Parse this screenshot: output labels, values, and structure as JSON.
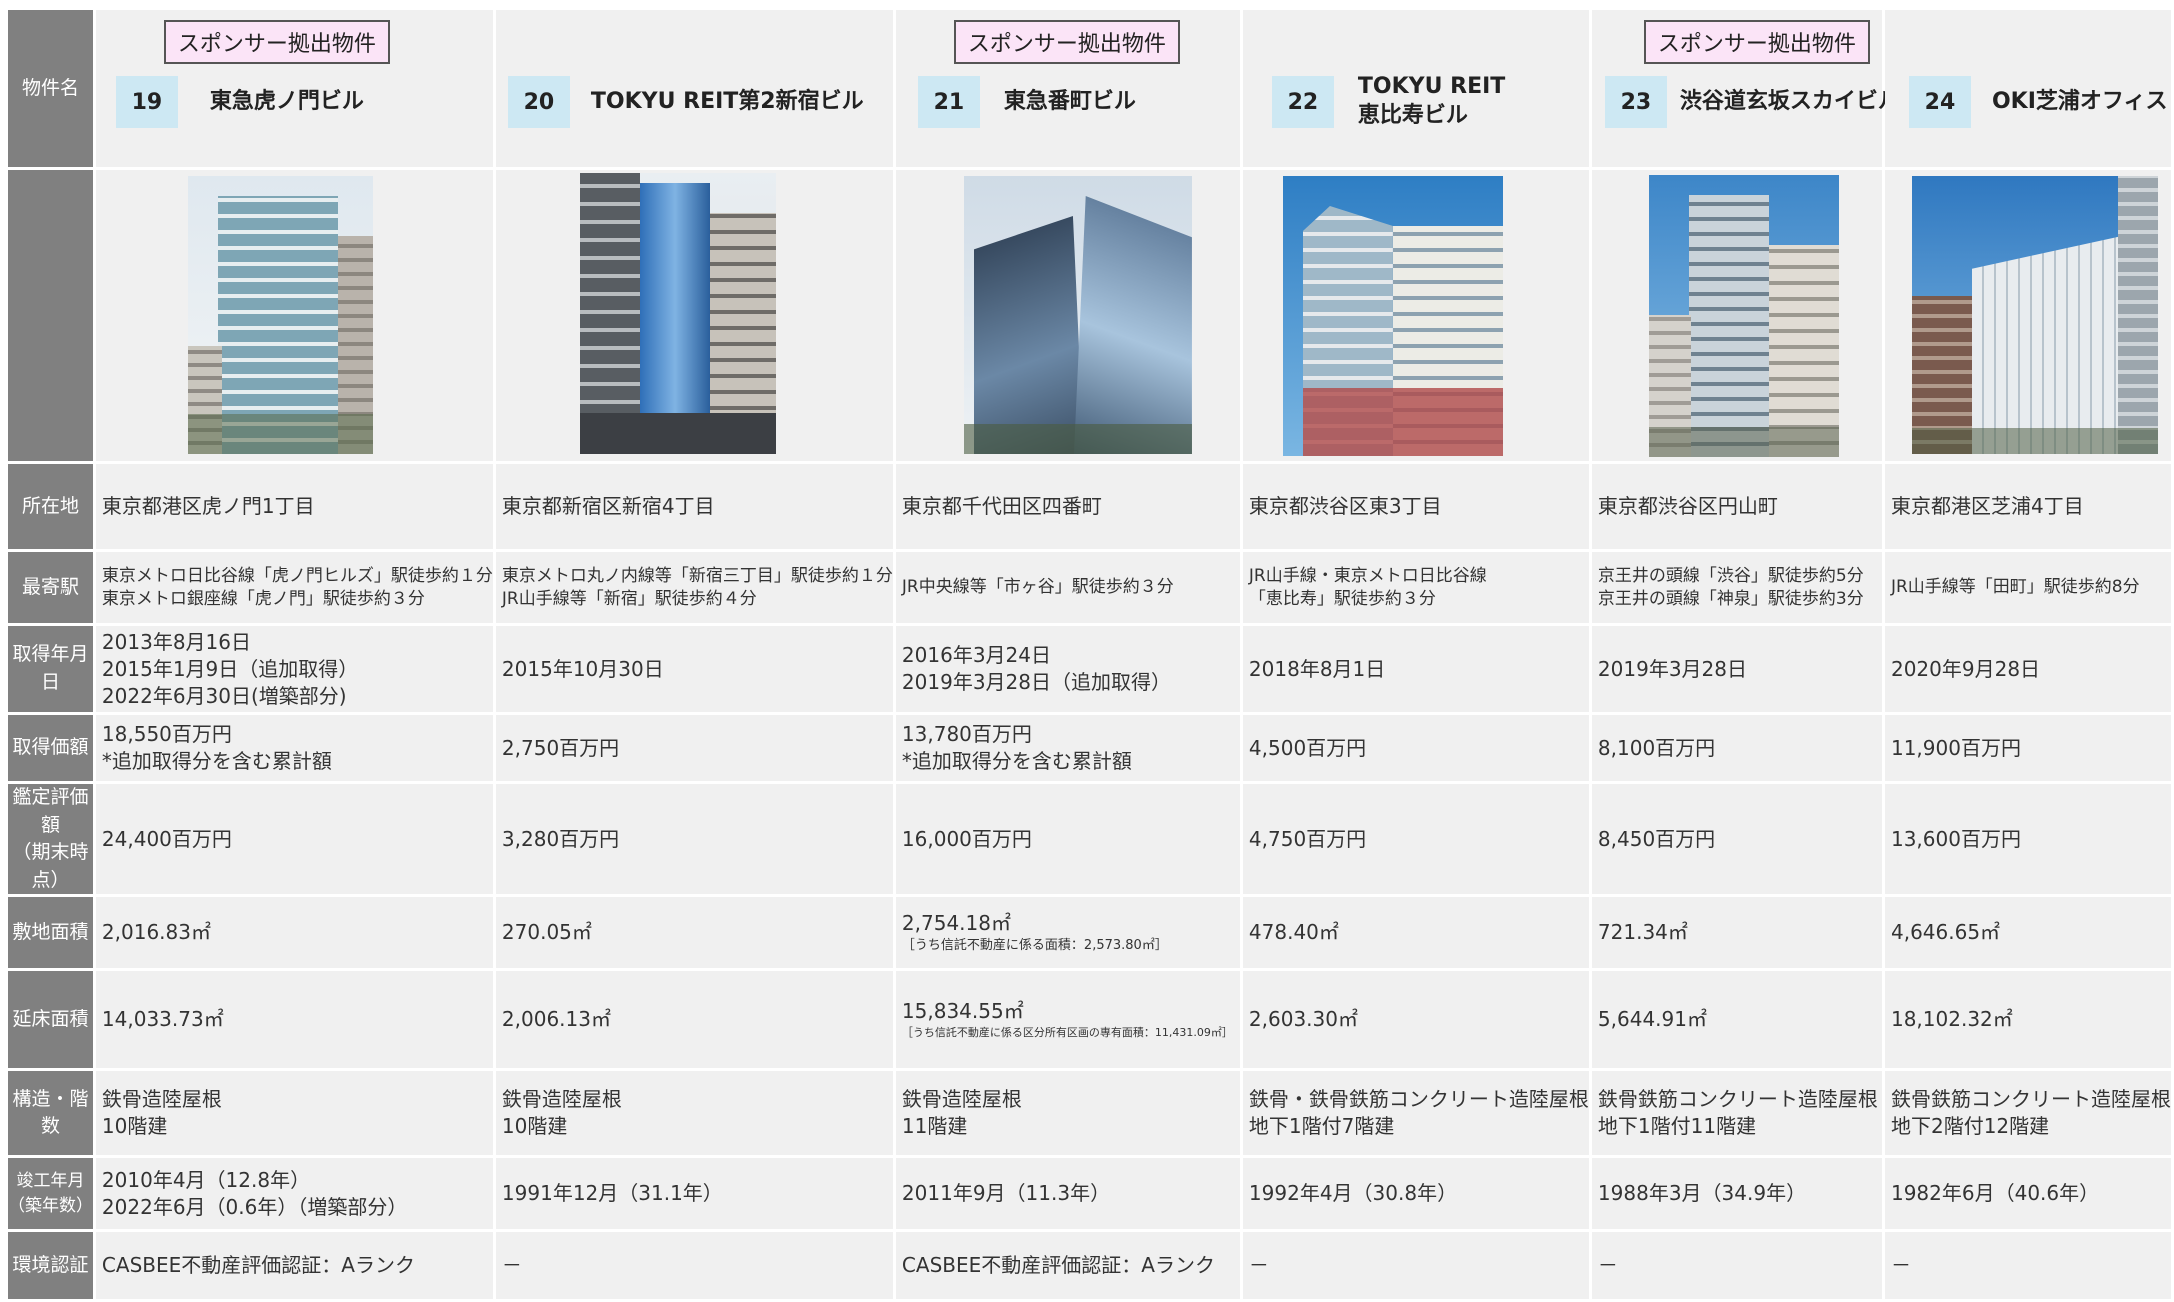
{
  "labels": {
    "name": "物件名",
    "location": "所在地",
    "station": "最寄駅",
    "acq_date": "取得年月日",
    "acq_price": "取得価額",
    "appraisal": [
      "鑑定評価額",
      "（期末時点）"
    ],
    "land_area": "敷地面積",
    "floor_area": "延床面積",
    "structure": "構造・階数",
    "completion": "竣工年月（築年数）",
    "env_cert": "環境認証"
  },
  "sponsor_badge": "スポンサー拠出物件",
  "properties": [
    {
      "number": "19",
      "name": [
        "東急虎ノ門ビル"
      ],
      "sponsor": true,
      "photo": "building-photo",
      "location": "東京都港区虎ノ門1丁目",
      "station": [
        "東京メトロ日比谷線「虎ノ門ヒルズ」駅徒歩約１分",
        "東京メトロ銀座線「虎ノ門」駅徒歩約３分"
      ],
      "acq_date": [
        "2013年8月16日",
        "2015年1月9日（追加取得）",
        "2022年6月30日(増築部分)"
      ],
      "acq_price": [
        "18,550百万円",
        "*追加取得分を含む累計額"
      ],
      "appraisal": "24,400百万円",
      "land_area": "2,016.83㎡",
      "land_note": "",
      "floor_area": "14,033.73㎡",
      "floor_note": "",
      "structure": [
        "鉄骨造陸屋根",
        "10階建"
      ],
      "completion": [
        "2010年4月（12.8年）",
        "2022年6月（0.6年）（増築部分）"
      ],
      "env_cert": "CASBEE不動産評価認証：Aランク"
    },
    {
      "number": "20",
      "name": [
        "TOKYU REIT第2新宿ビル"
      ],
      "sponsor": false,
      "photo": "building-photo",
      "location": "東京都新宿区新宿4丁目",
      "station": [
        "東京メトロ丸ノ内線等「新宿三丁目」駅徒歩約１分",
        "JR山手線等「新宿」駅徒歩約４分"
      ],
      "acq_date": [
        "2015年10月30日"
      ],
      "acq_price": [
        "2,750百万円"
      ],
      "appraisal": "3,280百万円",
      "land_area": "270.05㎡",
      "land_note": "",
      "floor_area": "2,006.13㎡",
      "floor_note": "",
      "structure": [
        "鉄骨造陸屋根",
        "10階建"
      ],
      "completion": [
        "1991年12月（31.1年）"
      ],
      "env_cert": "－"
    },
    {
      "number": "21",
      "name": [
        "東急番町ビル"
      ],
      "sponsor": true,
      "photo": "building-photo",
      "location": "東京都千代田区四番町",
      "station": [
        "JR中央線等「市ヶ谷」駅徒歩約３分"
      ],
      "acq_date": [
        "2016年3月24日",
        "2019年3月28日（追加取得）"
      ],
      "acq_price": [
        "13,780百万円",
        "*追加取得分を含む累計額"
      ],
      "appraisal": "16,000百万円",
      "land_area": "2,754.18㎡",
      "land_note": "［うち信託不動産に係る面積：2,573.80㎡］",
      "floor_area": "15,834.55㎡",
      "floor_note": "［うち信託不動産に係る区分所有区画の専有面積：11,431.09㎡］",
      "structure": [
        "鉄骨造陸屋根",
        "11階建"
      ],
      "completion": [
        "2011年9月（11.3年）"
      ],
      "env_cert": "CASBEE不動産評価認証：Aランク"
    },
    {
      "number": "22",
      "name": [
        "TOKYU REIT",
        "恵比寿ビル"
      ],
      "sponsor": false,
      "photo": "building-photo",
      "location": "東京都渋谷区東3丁目",
      "station": [
        "JR山手線・東京メトロ日比谷線",
        "「恵比寿」駅徒歩約３分"
      ],
      "acq_date": [
        "2018年8月1日"
      ],
      "acq_price": [
        "4,500百万円"
      ],
      "appraisal": "4,750百万円",
      "land_area": "478.40㎡",
      "land_note": "",
      "floor_area": "2,603.30㎡",
      "floor_note": "",
      "structure": [
        "鉄骨・鉄骨鉄筋コンクリート造陸屋根",
        "地下1階付7階建"
      ],
      "completion": [
        "1992年4月（30.8年）"
      ],
      "env_cert": "－"
    },
    {
      "number": "23",
      "name": [
        "渋谷道玄坂スカイビル"
      ],
      "sponsor": true,
      "photo": "building-photo",
      "location": "東京都渋谷区円山町",
      "station": [
        "京王井の頭線「渋谷」駅徒歩約5分",
        "京王井の頭線「神泉」駅徒歩約3分"
      ],
      "acq_date": [
        "2019年3月28日"
      ],
      "acq_price": [
        "8,100百万円"
      ],
      "appraisal": "8,450百万円",
      "land_area": "721.34㎡",
      "land_note": "",
      "floor_area": "5,644.91㎡",
      "floor_note": "",
      "structure": [
        "鉄骨鉄筋コンクリート造陸屋根",
        "地下1階付11階建"
      ],
      "completion": [
        "1988年3月（34.9年）"
      ],
      "env_cert": "－"
    },
    {
      "number": "24",
      "name": [
        "OKI芝浦オフィス"
      ],
      "sponsor": false,
      "photo": "building-photo",
      "location": "東京都港区芝浦4丁目",
      "station": [
        "JR山手線等「田町」駅徒歩約8分"
      ],
      "acq_date": [
        "2020年9月28日"
      ],
      "acq_price": [
        "11,900百万円"
      ],
      "appraisal": "13,600百万円",
      "land_area": "4,646.65㎡",
      "land_note": "",
      "floor_area": "18,102.32㎡",
      "floor_note": "",
      "structure": [
        "鉄骨鉄筋コンクリート造陸屋根",
        "地下2階付12階建"
      ],
      "completion": [
        "1982年6月（40.6年）"
      ],
      "env_cert": "－"
    }
  ],
  "colors": {
    "label_bg": "#808080",
    "cell_bg": "#f0f0f0",
    "sponsor_bg": "#fbe4f7",
    "number_bg": "#cde8f3"
  }
}
